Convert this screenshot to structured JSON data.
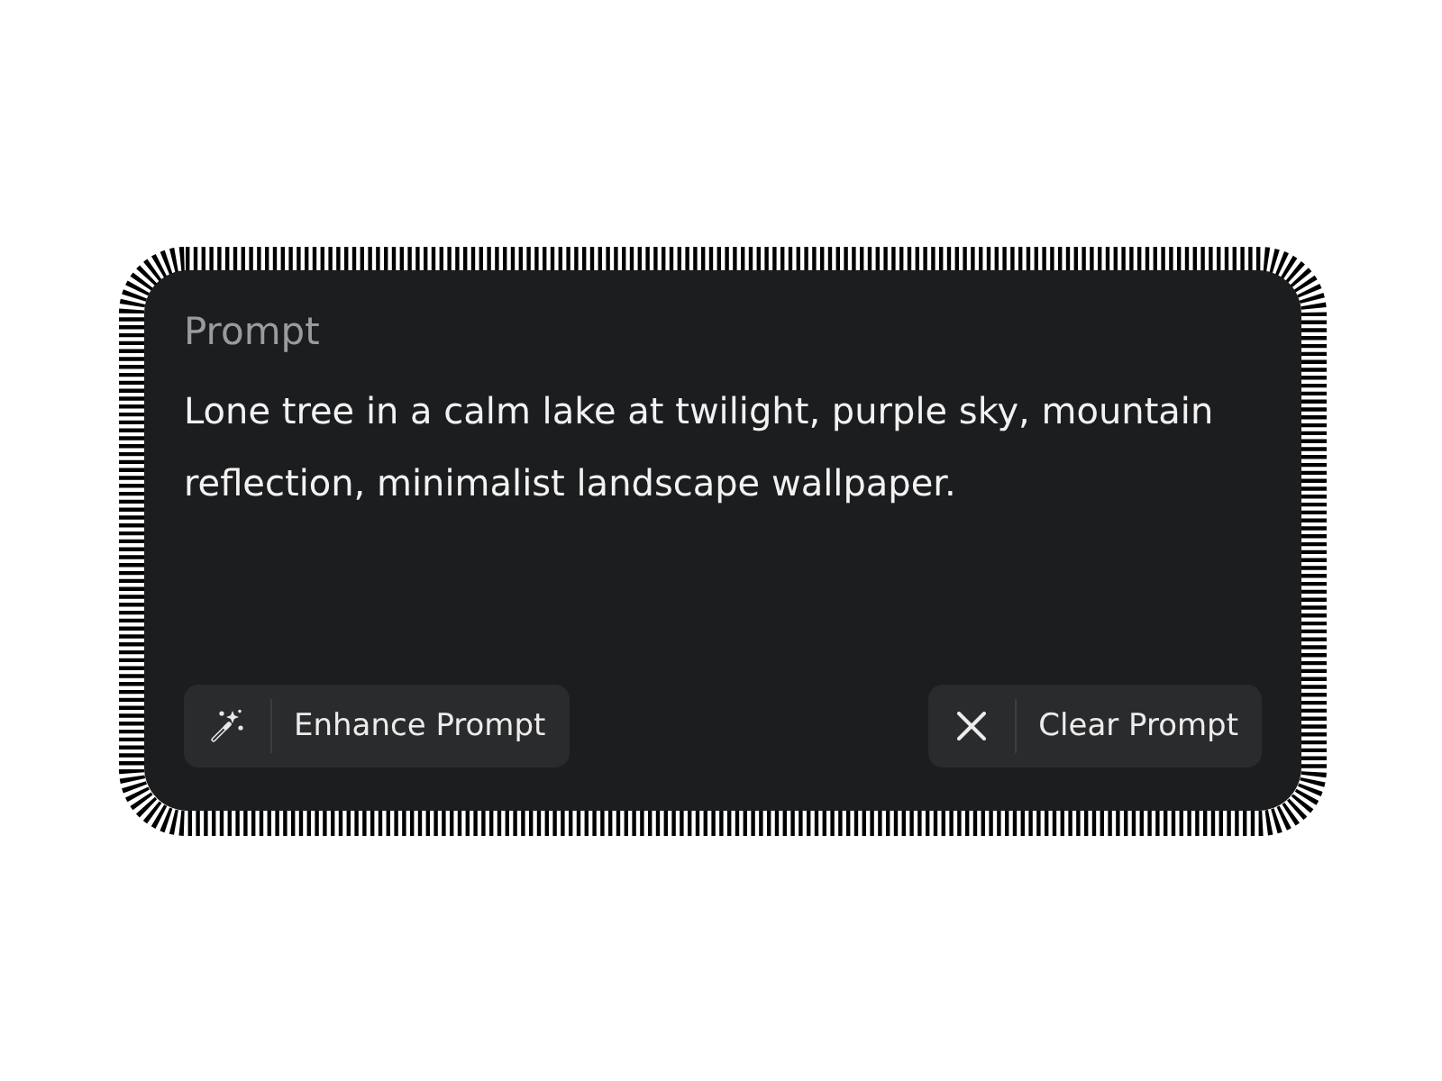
{
  "prompt": {
    "label": "Prompt",
    "value": "Lone tree in a calm lake at twilight, purple sky, mountain reflection, minimalist landscape wallpaper."
  },
  "actions": [
    {
      "kind": "enhance",
      "label": "Enhance Prompt"
    },
    {
      "kind": "clear",
      "label": "Clear Prompt"
    }
  ]
}
